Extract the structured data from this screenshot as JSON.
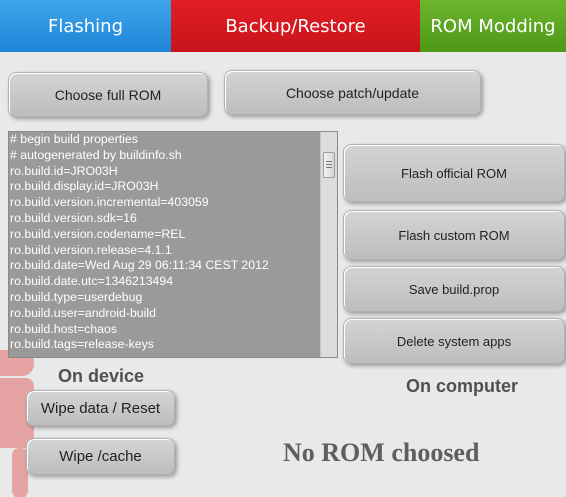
{
  "tabs": [
    {
      "label": "Flashing",
      "color": "#2a92e0"
    },
    {
      "label": "Backup/Restore",
      "color": "#d81b22"
    },
    {
      "label": "ROM Modding",
      "color": "#5ea523"
    }
  ],
  "toolbar": {
    "choose_full_rom": "Choose full ROM",
    "choose_patch": "Choose patch/update"
  },
  "build_prop": {
    "lines": [
      "# begin build properties",
      "# autogenerated by buildinfo.sh",
      "ro.build.id=JRO03H",
      "ro.build.display.id=JRO03H",
      "ro.build.version.incremental=403059",
      "ro.build.version.sdk=16",
      "ro.build.version.codename=REL",
      "ro.build.version.release=4.1.1",
      "ro.build.date=Wed Aug 29 06:11:34 CEST 2012",
      "ro.build.date.utc=1346213494",
      "ro.build.type=userdebug",
      "ro.build.user=android-build",
      "ro.build.host=chaos",
      "ro.build.tags=release-keys"
    ]
  },
  "computer_actions": {
    "flash_official": "Flash official ROM",
    "flash_custom": "Flash custom ROM",
    "save_build": "Save build.prop",
    "delete_system": "Delete system apps"
  },
  "device": {
    "section_label": "On device",
    "wipe_data": "Wipe data / Reset",
    "wipe_cache": "Wipe /cache"
  },
  "computer": {
    "section_label": "On computer"
  },
  "status": {
    "message": "No ROM choosed"
  }
}
